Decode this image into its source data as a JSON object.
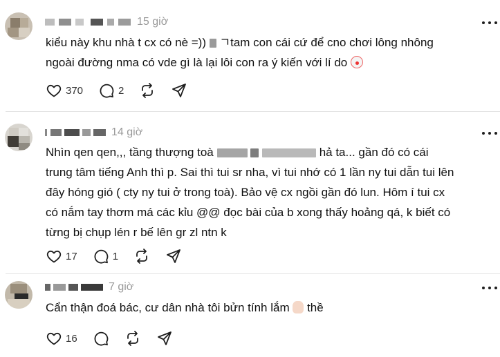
{
  "comments": [
    {
      "time": "15 giờ",
      "text_line1_a": "kiểu này khu nhà t cx có nè =))",
      "text_line1_b": "ㄱtam con cái cứ để cno chơi lông nhông",
      "text_line2": "ngoài đường nma có vde gì là lại lôi con ra ý kiến với lí do",
      "emoji_icon": "clown-face-icon",
      "likes": "370",
      "replies": "2"
    },
    {
      "time": "14 giờ",
      "line1_a": "Nhìn qen qen,,, tầng thượng toà",
      "line1_b": "hả ta... gần đó có cái",
      "line2": "trung tâm tiếng Anh thì p. Sai thì tui sr nha, vì tui nhớ có 1 lần ny tui dẫn tui lên",
      "line3": "đây hóng gió ( cty ny tui ở trong toà). Bảo vệ cx ngồi gần đó lun. Hôm í tui cx",
      "line4": "có nắm tay thơm má các kỉu @@ đọc bài của b xong thấy hoảng qá, k biết có",
      "line5": "từng bị chụp lén r bế lên gr zl ntn k",
      "likes": "17",
      "replies": "1"
    },
    {
      "time": "7 giờ",
      "text_a": "Cẩn thận đoá bác, cư dân nhà tôi bửn tính lắm",
      "text_b": "thề",
      "emoji_icon": "folded-hands-icon",
      "likes": "16",
      "replies": ""
    }
  ],
  "colors": {
    "text": "#101010",
    "time": "#999999",
    "divider": "#e3e3e3",
    "icon": "#1e1e1e"
  }
}
